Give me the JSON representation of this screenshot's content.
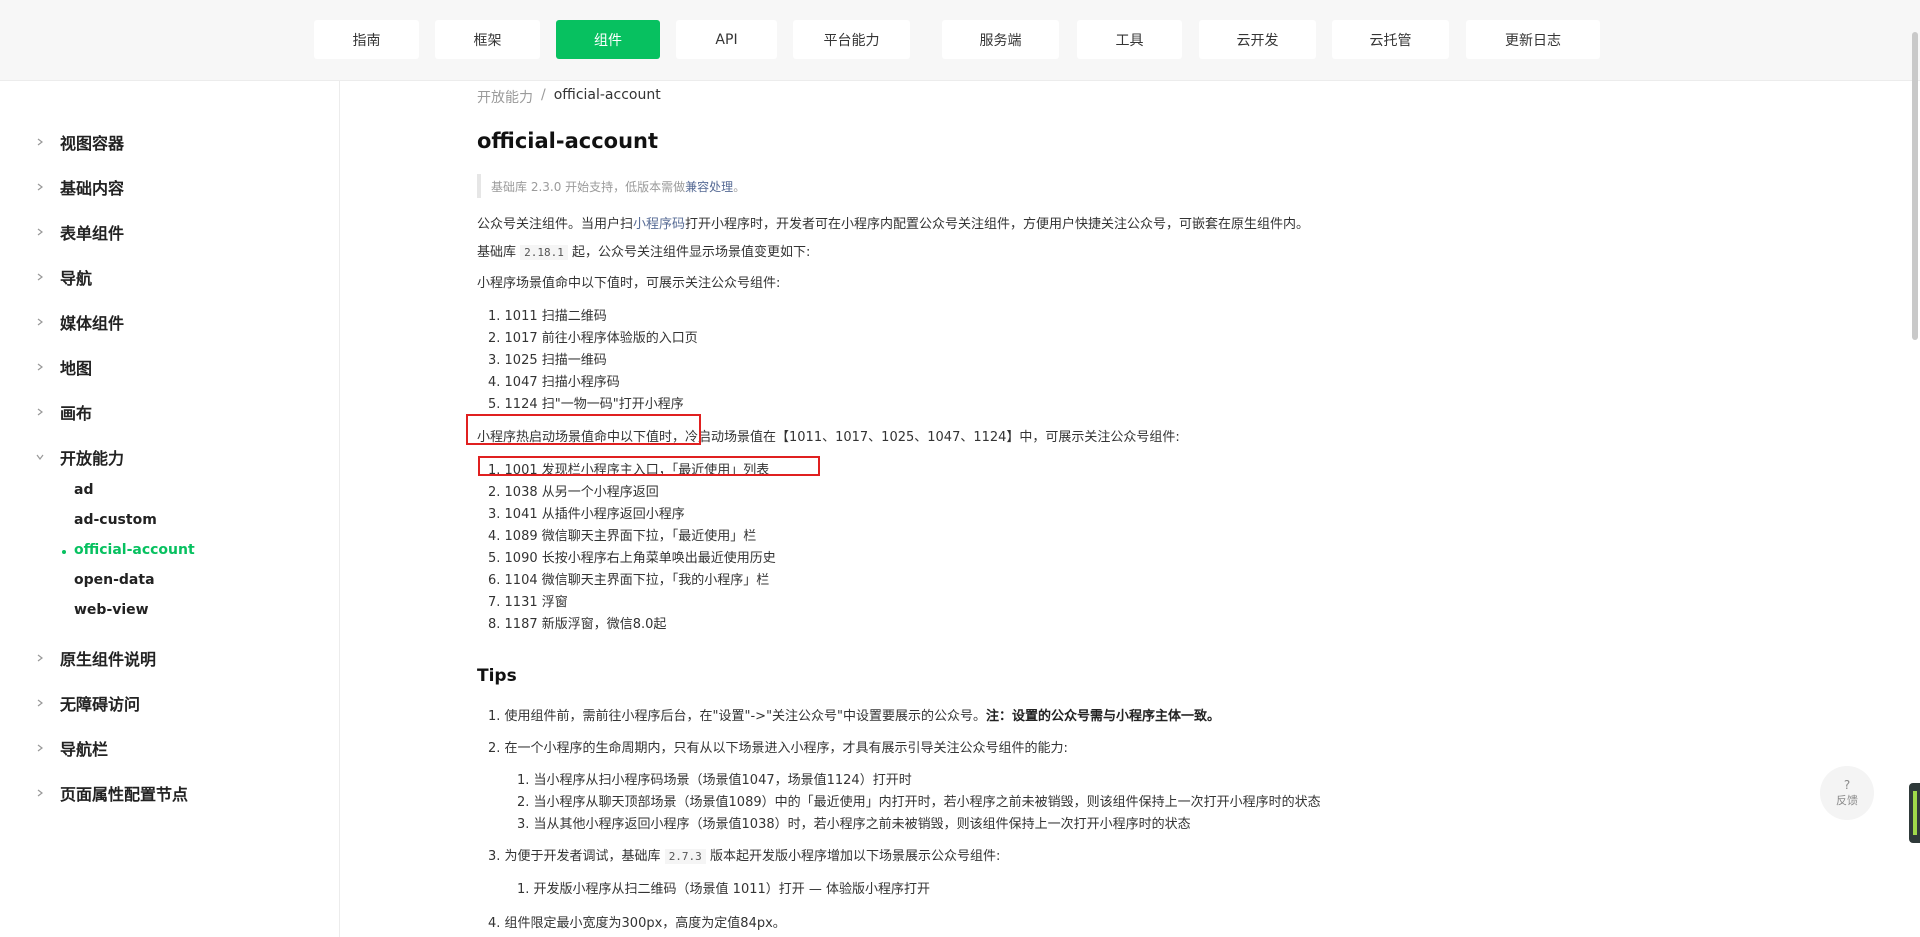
{
  "nav": {
    "tabs": [
      {
        "label": "指南"
      },
      {
        "label": "框架"
      },
      {
        "label": "组件",
        "active": true
      },
      {
        "label": "API"
      },
      {
        "label": "平台能力"
      },
      {
        "label": "服务端"
      },
      {
        "label": "工具"
      },
      {
        "label": "云开发"
      },
      {
        "label": "云托管"
      },
      {
        "label": "更新日志"
      }
    ]
  },
  "sidebar": {
    "items": [
      {
        "label": "视图容器"
      },
      {
        "label": "基础内容"
      },
      {
        "label": "表单组件"
      },
      {
        "label": "导航"
      },
      {
        "label": "媒体组件"
      },
      {
        "label": "地图"
      },
      {
        "label": "画布"
      },
      {
        "label": "开放能力",
        "expanded": true
      },
      {
        "label": "原生组件说明"
      },
      {
        "label": "无障碍访问"
      },
      {
        "label": "导航栏"
      },
      {
        "label": "页面属性配置节点"
      }
    ],
    "subitems": [
      {
        "label": "ad"
      },
      {
        "label": "ad-custom"
      },
      {
        "label": "official-account",
        "active": true
      },
      {
        "label": "open-data"
      },
      {
        "label": "web-view"
      }
    ]
  },
  "breadcrumb": {
    "parent": "开放能力",
    "separator": "/",
    "current": "official-account"
  },
  "page": {
    "title": "official-account",
    "note_text": "基础库 2.3.0 开始支持，低版本需做",
    "note_link": "兼容处理",
    "note_end": "。",
    "intro_a": "公众号关注组件。当用户扫",
    "intro_link": "小程序码",
    "intro_b": "打开小程序时，开发者可在小程序内配置公众号关注组件，方便用户快捷关注公众号，可嵌套在原生组件内。",
    "lib_a": "基础库",
    "lib_code": "2.18.1",
    "lib_b": "起，公众号关注组件显示场景值变更如下:",
    "cold_heading": "小程序场景值命中以下值时，可展示关注公众号组件:",
    "cold_list": [
      "1. 1011 扫描二维码",
      "2. 1017 前往小程序体验版的入口页",
      "3. 1025 扫描一维码",
      "4. 1047 扫描小程序码",
      "5. 1124 扫\"一物一码\"打开小程序"
    ],
    "hot_heading_a": "小程序热启动场景值命中以下值时，",
    "hot_heading_b": "冷启动场景值在【1011、1017、1025、1047、1124】中，可展示关注公众号组件:",
    "hot_list": [
      "1. 1001 发现栏小程序主入口，「最近使用」列表",
      "2. 1038 从另一个小程序返回",
      "3. 1041 从插件小程序返回小程序",
      "4. 1089 微信聊天主界面下拉，「最近使用」栏",
      "5. 1090 长按小程序右上角菜单唤出最近使用历史",
      "6. 1104 微信聊天主界面下拉，「我的小程序」栏",
      "7. 1131 浮窗",
      "8. 1187 新版浮窗，微信8.0起"
    ],
    "tips_title": "Tips",
    "tip1_a": "1. 使用组件前，需前往小程序后台，在\"设置\"->\"关注公众号\"中设置要展示的公众号。",
    "tip1_b": "注：设置的公众号需与小程序主体一致。",
    "tip2": "2. 在一个小程序的生命周期内，只有从以下场景进入小程序，才具有展示引导关注公众号组件的能力:",
    "tip2_list": [
      "1. 当小程序从扫小程序码场景（场景值1047，场景值1124）打开时",
      "2. 当小程序从聊天顶部场景（场景值1089）中的「最近使用」内打开时，若小程序之前未被销毁，则该组件保持上一次打开小程序时的状态",
      "3. 当从其他小程序返回小程序（场景值1038）时，若小程序之前未被销毁，则该组件保持上一次打开小程序时的状态"
    ],
    "tip3_a": "3. 为便于开发者调试，基础库",
    "tip3_code": "2.7.3",
    "tip3_b": "版本起开发版小程序增加以下场景展示公众号组件:",
    "tip3_list": [
      "1. 开发版小程序从扫二维码（场景值 1011）打开 — 体验版小程序打开"
    ],
    "tip4": "4. 组件限定最小宽度为300px，高度为定值84px。"
  },
  "feedback": {
    "icon": "?",
    "label": "反馈"
  },
  "colors": {
    "accent": "#07c160",
    "link": "#576b95",
    "highlight": "#e02020"
  }
}
